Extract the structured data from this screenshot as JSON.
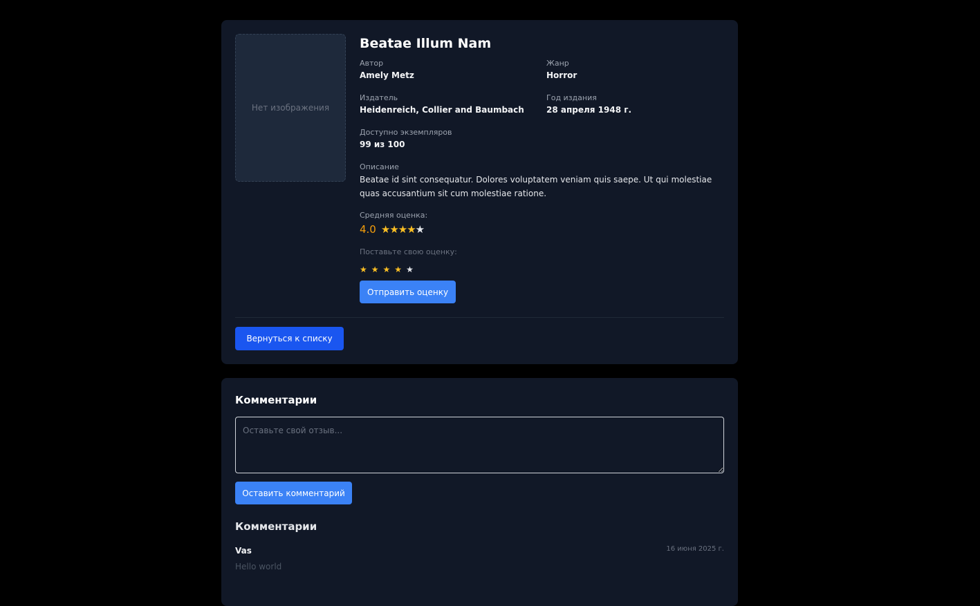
{
  "book": {
    "cover_placeholder": "Нет изображения",
    "title": "Beatae Illum Nam",
    "author_label": "Автор",
    "author": "Amely Metz",
    "genre_label": "Жанр",
    "genre": "Horror",
    "publisher_label": "Издатель",
    "publisher": "Heidenreich, Collier and Baumbach",
    "year_label": "Год издания",
    "year": "28 апреля 1948 г.",
    "available_label": "Доступно экземпляров",
    "available": "99 из 100",
    "description_label": "Описание",
    "description": "Beatae id sint consequatur. Dolores voluptatem veniam quis saepe. Ut qui molestiae quas accusantium sit cum molestiae ratione.",
    "avg_label": "Средняя оценка:",
    "avg_value": "4.0",
    "avg_stars_filled": 4,
    "avg_stars_total": 5,
    "rate_label": "Поставьте свою оценку:",
    "rate_stars_selected": 4,
    "rate_button": "Отправить оценку",
    "back_button": "Вернуться к списку"
  },
  "comments": {
    "title": "Комментарии",
    "placeholder": "Оставьте свой отзыв...",
    "submit_button": "Оставить комментарий",
    "list_title": "Комментарии",
    "items": [
      {
        "author": "Vas",
        "date": "16 июня 2025 г.",
        "text": "Hello world"
      }
    ]
  },
  "colors": {
    "star_filled": "#fbbf24",
    "star_empty": "#e5e7eb",
    "accent": "#3b82f6",
    "back_button": "#1a56f0"
  }
}
